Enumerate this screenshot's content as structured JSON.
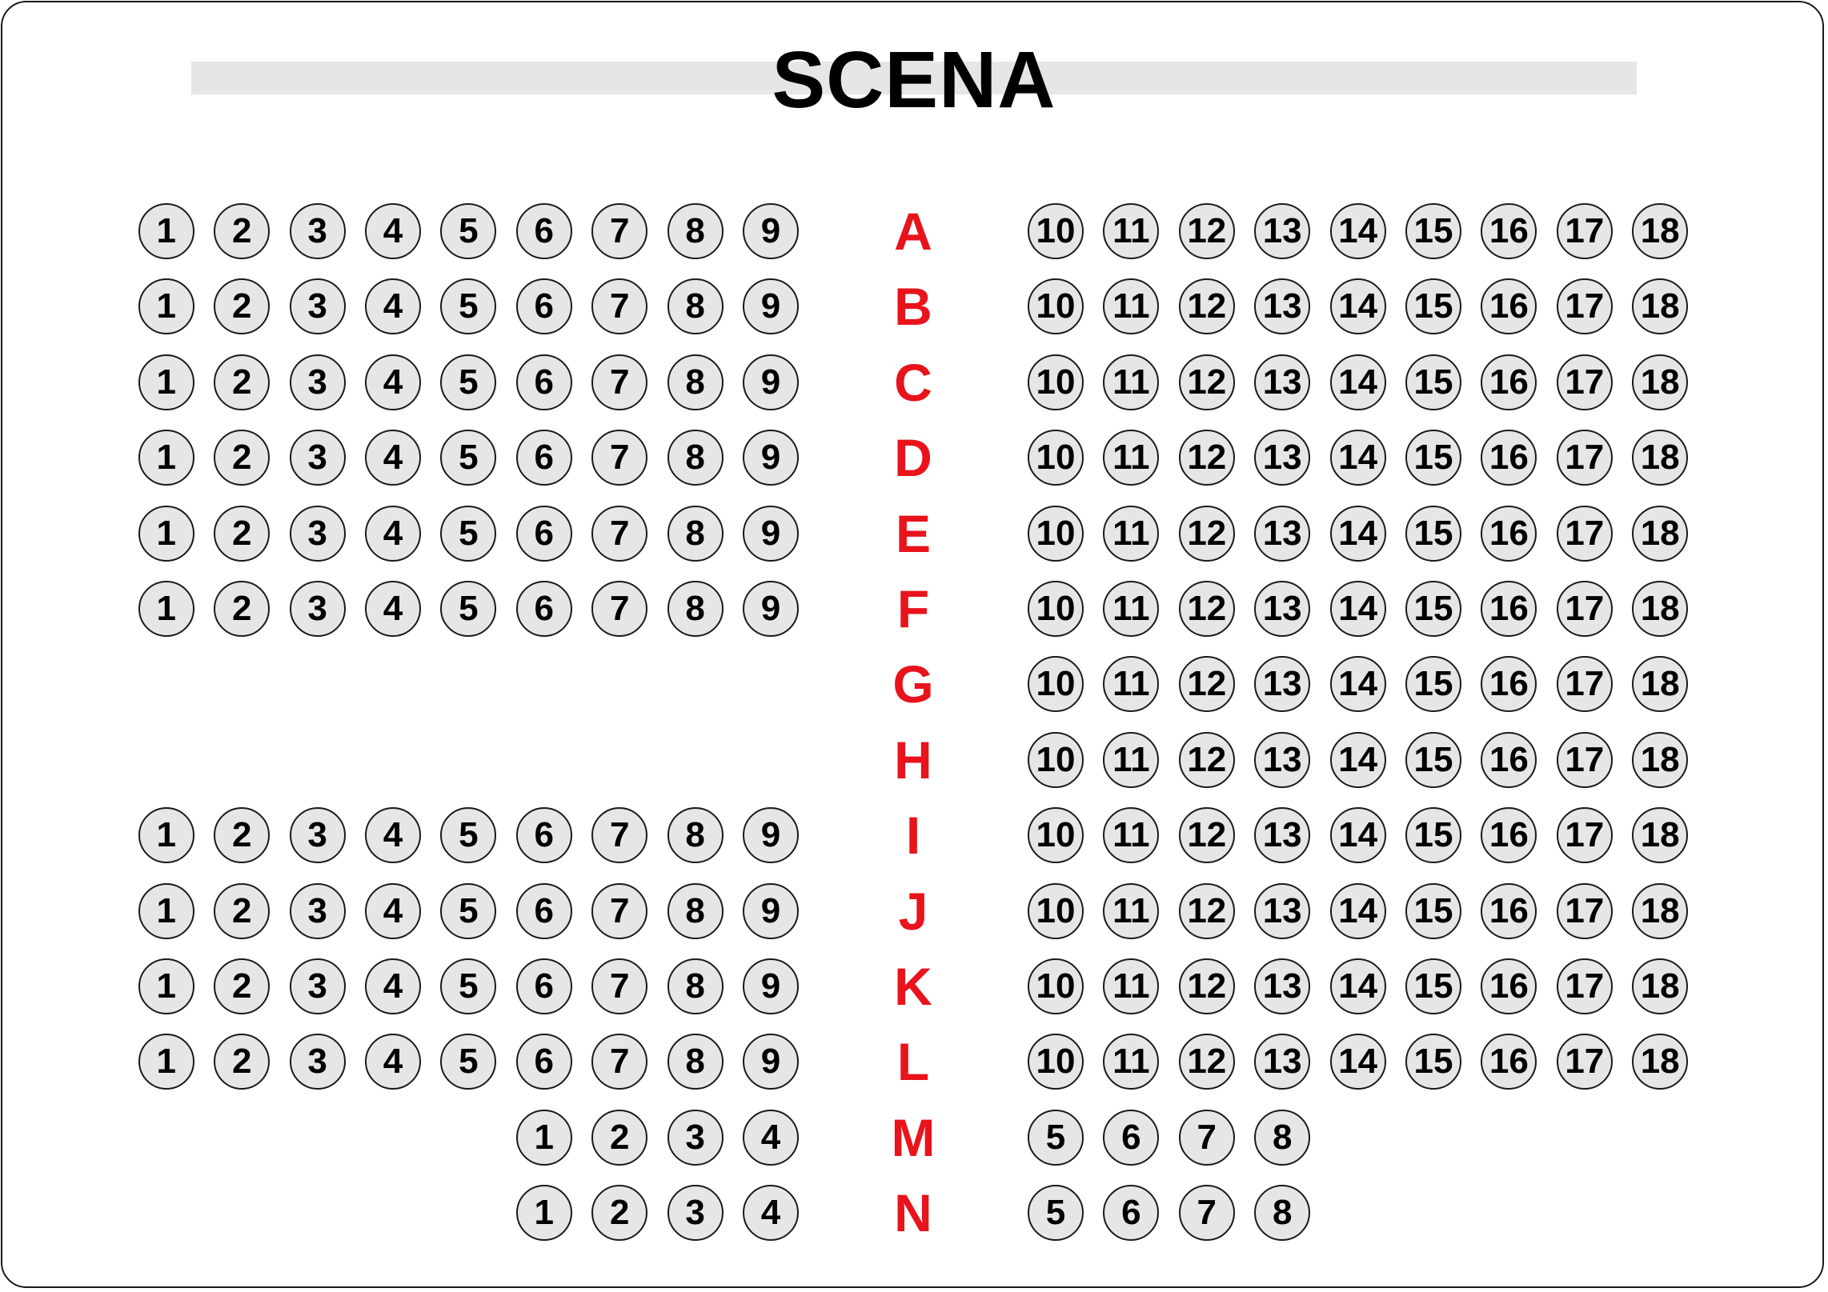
{
  "stage": {
    "title": "SCENA"
  },
  "colors": {
    "seat_fill": "#e6e6e6",
    "seat_border": "#1a1a1a",
    "row_label": "#e8131b",
    "stage_bar": "#e6e6e6"
  },
  "rows": [
    {
      "label": "A",
      "left": [
        "1",
        "2",
        "3",
        "4",
        "5",
        "6",
        "7",
        "8",
        "9"
      ],
      "right": [
        "10",
        "11",
        "12",
        "13",
        "14",
        "15",
        "16",
        "17",
        "18"
      ]
    },
    {
      "label": "B",
      "left": [
        "1",
        "2",
        "3",
        "4",
        "5",
        "6",
        "7",
        "8",
        "9"
      ],
      "right": [
        "10",
        "11",
        "12",
        "13",
        "14",
        "15",
        "16",
        "17",
        "18"
      ]
    },
    {
      "label": "C",
      "left": [
        "1",
        "2",
        "3",
        "4",
        "5",
        "6",
        "7",
        "8",
        "9"
      ],
      "right": [
        "10",
        "11",
        "12",
        "13",
        "14",
        "15",
        "16",
        "17",
        "18"
      ]
    },
    {
      "label": "D",
      "left": [
        "1",
        "2",
        "3",
        "4",
        "5",
        "6",
        "7",
        "8",
        "9"
      ],
      "right": [
        "10",
        "11",
        "12",
        "13",
        "14",
        "15",
        "16",
        "17",
        "18"
      ]
    },
    {
      "label": "E",
      "left": [
        "1",
        "2",
        "3",
        "4",
        "5",
        "6",
        "7",
        "8",
        "9"
      ],
      "right": [
        "10",
        "11",
        "12",
        "13",
        "14",
        "15",
        "16",
        "17",
        "18"
      ]
    },
    {
      "label": "F",
      "left": [
        "1",
        "2",
        "3",
        "4",
        "5",
        "6",
        "7",
        "8",
        "9"
      ],
      "right": [
        "10",
        "11",
        "12",
        "13",
        "14",
        "15",
        "16",
        "17",
        "18"
      ]
    },
    {
      "label": "G",
      "left": [],
      "right": [
        "10",
        "11",
        "12",
        "13",
        "14",
        "15",
        "16",
        "17",
        "18"
      ]
    },
    {
      "label": "H",
      "left": [],
      "right": [
        "10",
        "11",
        "12",
        "13",
        "14",
        "15",
        "16",
        "17",
        "18"
      ]
    },
    {
      "label": "I",
      "left": [
        "1",
        "2",
        "3",
        "4",
        "5",
        "6",
        "7",
        "8",
        "9"
      ],
      "right": [
        "10",
        "11",
        "12",
        "13",
        "14",
        "15",
        "16",
        "17",
        "18"
      ]
    },
    {
      "label": "J",
      "left": [
        "1",
        "2",
        "3",
        "4",
        "5",
        "6",
        "7",
        "8",
        "9"
      ],
      "right": [
        "10",
        "11",
        "12",
        "13",
        "14",
        "15",
        "16",
        "17",
        "18"
      ]
    },
    {
      "label": "K",
      "left": [
        "1",
        "2",
        "3",
        "4",
        "5",
        "6",
        "7",
        "8",
        "9"
      ],
      "right": [
        "10",
        "11",
        "12",
        "13",
        "14",
        "15",
        "16",
        "17",
        "18"
      ]
    },
    {
      "label": "L",
      "left": [
        "1",
        "2",
        "3",
        "4",
        "5",
        "6",
        "7",
        "8",
        "9"
      ],
      "right": [
        "10",
        "11",
        "12",
        "13",
        "14",
        "15",
        "16",
        "17",
        "18"
      ]
    },
    {
      "label": "M",
      "left": [
        "1",
        "2",
        "3",
        "4"
      ],
      "right": [
        "5",
        "6",
        "7",
        "8"
      ]
    },
    {
      "label": "N",
      "left": [
        "1",
        "2",
        "3",
        "4"
      ],
      "right": [
        "5",
        "6",
        "7",
        "8"
      ]
    }
  ]
}
